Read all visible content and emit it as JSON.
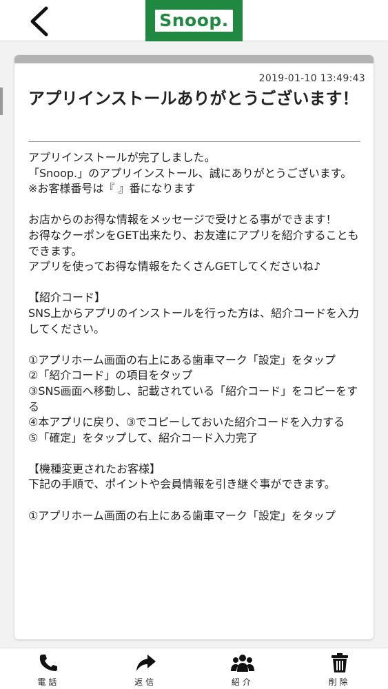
{
  "header": {
    "logo_text": "Snoop."
  },
  "message": {
    "timestamp": "2019-01-10 13:49:43",
    "title": "アプリインストールありがとうございます！",
    "body": "アプリインストールが完了しました。\n「Snoop.」のアプリインストール、誠にありがとうございます。\n※お客様番号は『 』番になります\n\nお店からのお得な情報をメッセージで受けとる事ができます！\nお得なクーポンをGET出来たり、お友達にアプリを紹介することもできます。\nアプリを使ってお得な情報をたくさんGETしてくださいね♪\n\n【紹介コード】\nSNS上からアプリのインストールを行った方は、紹介コードを入力してください。\n\n①アプリホーム画面の右上にある歯車マーク「設定」をタップ\n②「紹介コード」の項目をタップ\n③SNS画面へ移動し、記載されている「紹介コード」をコピーをする\n④本アプリに戻り、③でコピーしておいた紹介コードを入力する\n⑤「確定」をタップして、紹介コード入力完了\n\n【機種変更されたお客様】\n下記の手順で、ポイントや会員情報を引き継ぐ事ができます。\n\n①アプリホーム画面の右上にある歯車マーク「設定」をタップ"
  },
  "tabbar": {
    "items": [
      {
        "label": "電話",
        "icon": "phone-icon"
      },
      {
        "label": "返信",
        "icon": "reply-icon"
      },
      {
        "label": "紹介",
        "icon": "users-icon"
      },
      {
        "label": "削除",
        "icon": "trash-icon"
      }
    ]
  }
}
